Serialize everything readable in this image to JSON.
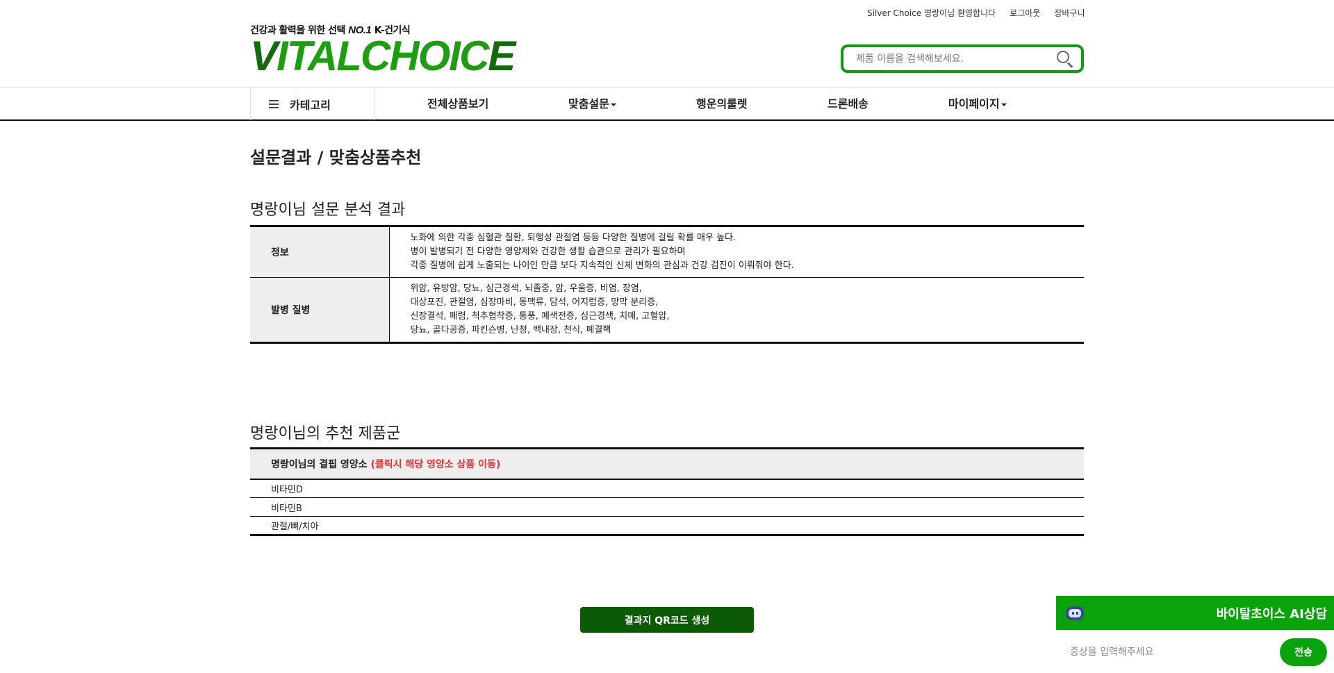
{
  "top_links": {
    "welcome": "Silver Choice 명랑이님 환영합니다",
    "logout": "로그아웃",
    "cart": "장바구니"
  },
  "brand": {
    "tagline_prefix": "건강과 활력을 위한 선택",
    "tagline_no1": "NO.1",
    "tagline_suffix": "K-건기식",
    "logo_text": "VITALCHOICE",
    "logo_color": "#1e9c12"
  },
  "search": {
    "placeholder": "제품 이름을 검색해보세요.",
    "value": ""
  },
  "nav": {
    "category_label": "카테고리",
    "items": [
      {
        "label": "전체상품보기",
        "dropdown": false
      },
      {
        "label": "맞춤설문",
        "dropdown": true
      },
      {
        "label": "행운의룰렛",
        "dropdown": false
      },
      {
        "label": "드론배송",
        "dropdown": false
      },
      {
        "label": "마이페이지",
        "dropdown": true
      }
    ]
  },
  "page_title": "설문결과 / 맞춤상품추천",
  "analysis": {
    "title": "명랑이님 설문 분석 결과",
    "rows": [
      {
        "label": "정보",
        "lines": [
          "노화에 의한 각종 심혈관 질환, 퇴행성 관절염 등등 다양한 질병에 걸릴 확률 매우 높다.",
          "병이 발병되기 전 다양한 영양제와 건강한 생활 습관으로 관리가 필요하며",
          "각종 질병에 쉽게 노출되는 나이인 만큼 보다 지속적인 신체 변화의 관심과 건강 검진이 이뤄줘야 한다."
        ]
      },
      {
        "label": "발병 질병",
        "lines": [
          "위암, 유방암, 당뇨, 심근경색, 뇌졸중, 암, 우울증, 비염, 장염,",
          "대상포진, 관절염, 심장마비, 동맥류, 담석, 어지럼증, 망막 분리증,",
          "신장결석, 폐렴, 척추협착증, 통풍, 폐색전증, 심근경색, 치매, 고혈압,",
          "당뇨, 골다공증, 파킨슨병, 난청, 백내장, 천식, 폐결핵"
        ]
      }
    ]
  },
  "recommend": {
    "title": "명랑이님의 추천 제품군",
    "header_label": "명랑이님의 결핍 영양소",
    "header_hint": "(클릭시 해당 영양소 상품 이동)",
    "hint_color": "#e53535",
    "items": [
      "비타민D",
      "비타민B",
      "관절/뼈/치아"
    ]
  },
  "qr_button": "결과지 QR코드 생성",
  "chat": {
    "title": "바이탈초이스 AI상담",
    "placeholder": "증상을 입력해주세요",
    "send": "전송",
    "color": "#0ba30b"
  }
}
